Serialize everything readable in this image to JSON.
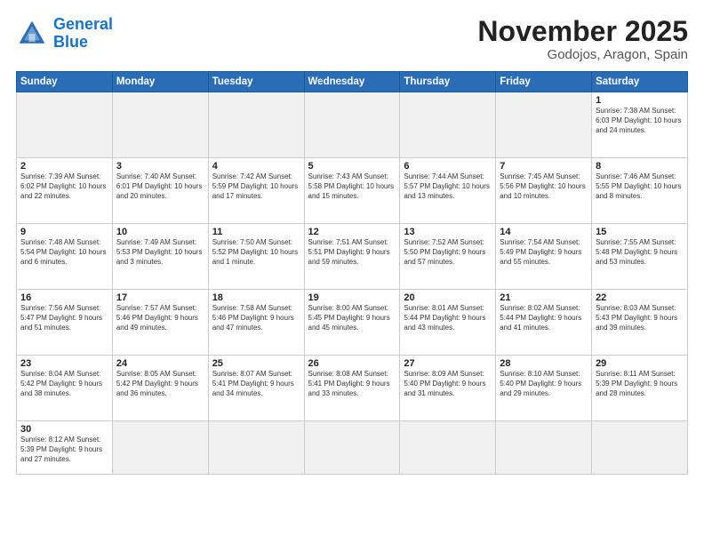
{
  "header": {
    "logo_line1": "General",
    "logo_line2": "Blue",
    "month": "November 2025",
    "location": "Godojos, Aragon, Spain"
  },
  "weekdays": [
    "Sunday",
    "Monday",
    "Tuesday",
    "Wednesday",
    "Thursday",
    "Friday",
    "Saturday"
  ],
  "weeks": [
    [
      {
        "day": "",
        "info": ""
      },
      {
        "day": "",
        "info": ""
      },
      {
        "day": "",
        "info": ""
      },
      {
        "day": "",
        "info": ""
      },
      {
        "day": "",
        "info": ""
      },
      {
        "day": "",
        "info": ""
      },
      {
        "day": "1",
        "info": "Sunrise: 7:38 AM\nSunset: 6:03 PM\nDaylight: 10 hours\nand 24 minutes."
      }
    ],
    [
      {
        "day": "2",
        "info": "Sunrise: 7:39 AM\nSunset: 6:02 PM\nDaylight: 10 hours\nand 22 minutes."
      },
      {
        "day": "3",
        "info": "Sunrise: 7:40 AM\nSunset: 6:01 PM\nDaylight: 10 hours\nand 20 minutes."
      },
      {
        "day": "4",
        "info": "Sunrise: 7:42 AM\nSunset: 5:59 PM\nDaylight: 10 hours\nand 17 minutes."
      },
      {
        "day": "5",
        "info": "Sunrise: 7:43 AM\nSunset: 5:58 PM\nDaylight: 10 hours\nand 15 minutes."
      },
      {
        "day": "6",
        "info": "Sunrise: 7:44 AM\nSunset: 5:57 PM\nDaylight: 10 hours\nand 13 minutes."
      },
      {
        "day": "7",
        "info": "Sunrise: 7:45 AM\nSunset: 5:56 PM\nDaylight: 10 hours\nand 10 minutes."
      },
      {
        "day": "8",
        "info": "Sunrise: 7:46 AM\nSunset: 5:55 PM\nDaylight: 10 hours\nand 8 minutes."
      }
    ],
    [
      {
        "day": "9",
        "info": "Sunrise: 7:48 AM\nSunset: 5:54 PM\nDaylight: 10 hours\nand 6 minutes."
      },
      {
        "day": "10",
        "info": "Sunrise: 7:49 AM\nSunset: 5:53 PM\nDaylight: 10 hours\nand 3 minutes."
      },
      {
        "day": "11",
        "info": "Sunrise: 7:50 AM\nSunset: 5:52 PM\nDaylight: 10 hours\nand 1 minute."
      },
      {
        "day": "12",
        "info": "Sunrise: 7:51 AM\nSunset: 5:51 PM\nDaylight: 9 hours\nand 59 minutes."
      },
      {
        "day": "13",
        "info": "Sunrise: 7:52 AM\nSunset: 5:50 PM\nDaylight: 9 hours\nand 57 minutes."
      },
      {
        "day": "14",
        "info": "Sunrise: 7:54 AM\nSunset: 5:49 PM\nDaylight: 9 hours\nand 55 minutes."
      },
      {
        "day": "15",
        "info": "Sunrise: 7:55 AM\nSunset: 5:48 PM\nDaylight: 9 hours\nand 53 minutes."
      }
    ],
    [
      {
        "day": "16",
        "info": "Sunrise: 7:56 AM\nSunset: 5:47 PM\nDaylight: 9 hours\nand 51 minutes."
      },
      {
        "day": "17",
        "info": "Sunrise: 7:57 AM\nSunset: 5:46 PM\nDaylight: 9 hours\nand 49 minutes."
      },
      {
        "day": "18",
        "info": "Sunrise: 7:58 AM\nSunset: 5:46 PM\nDaylight: 9 hours\nand 47 minutes."
      },
      {
        "day": "19",
        "info": "Sunrise: 8:00 AM\nSunset: 5:45 PM\nDaylight: 9 hours\nand 45 minutes."
      },
      {
        "day": "20",
        "info": "Sunrise: 8:01 AM\nSunset: 5:44 PM\nDaylight: 9 hours\nand 43 minutes."
      },
      {
        "day": "21",
        "info": "Sunrise: 8:02 AM\nSunset: 5:44 PM\nDaylight: 9 hours\nand 41 minutes."
      },
      {
        "day": "22",
        "info": "Sunrise: 8:03 AM\nSunset: 5:43 PM\nDaylight: 9 hours\nand 39 minutes."
      }
    ],
    [
      {
        "day": "23",
        "info": "Sunrise: 8:04 AM\nSunset: 5:42 PM\nDaylight: 9 hours\nand 38 minutes."
      },
      {
        "day": "24",
        "info": "Sunrise: 8:05 AM\nSunset: 5:42 PM\nDaylight: 9 hours\nand 36 minutes."
      },
      {
        "day": "25",
        "info": "Sunrise: 8:07 AM\nSunset: 5:41 PM\nDaylight: 9 hours\nand 34 minutes."
      },
      {
        "day": "26",
        "info": "Sunrise: 8:08 AM\nSunset: 5:41 PM\nDaylight: 9 hours\nand 33 minutes."
      },
      {
        "day": "27",
        "info": "Sunrise: 8:09 AM\nSunset: 5:40 PM\nDaylight: 9 hours\nand 31 minutes."
      },
      {
        "day": "28",
        "info": "Sunrise: 8:10 AM\nSunset: 5:40 PM\nDaylight: 9 hours\nand 29 minutes."
      },
      {
        "day": "29",
        "info": "Sunrise: 8:11 AM\nSunset: 5:39 PM\nDaylight: 9 hours\nand 28 minutes."
      }
    ],
    [
      {
        "day": "30",
        "info": "Sunrise: 8:12 AM\nSunset: 5:39 PM\nDaylight: 9 hours\nand 27 minutes."
      },
      {
        "day": "",
        "info": ""
      },
      {
        "day": "",
        "info": ""
      },
      {
        "day": "",
        "info": ""
      },
      {
        "day": "",
        "info": ""
      },
      {
        "day": "",
        "info": ""
      },
      {
        "day": "",
        "info": ""
      }
    ]
  ]
}
